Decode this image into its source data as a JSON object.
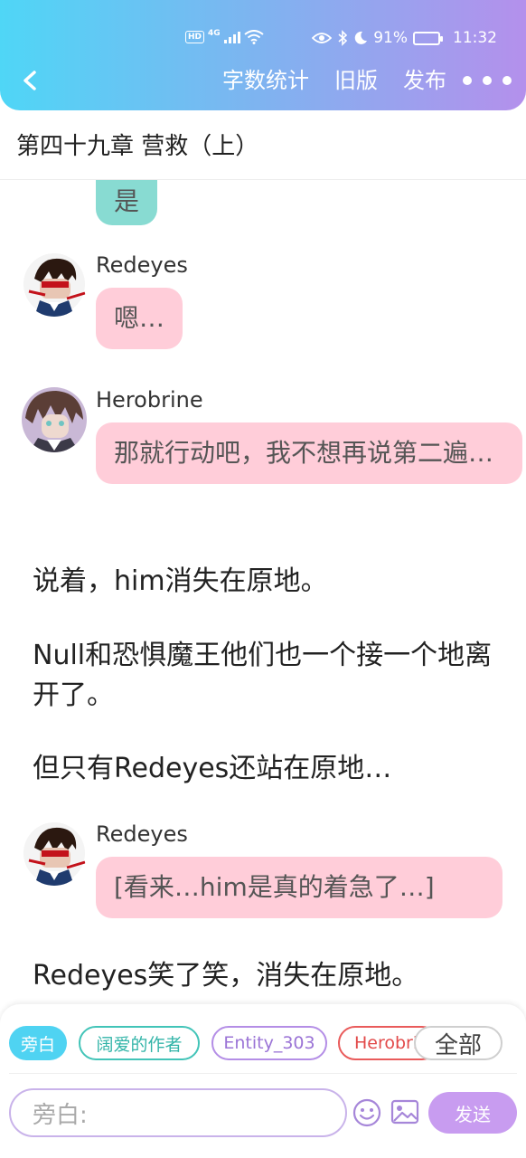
{
  "status_bar": {
    "hd": "HD",
    "network": "4G",
    "battery_percent": "91%",
    "battery_level": 0.91,
    "time": "11:32"
  },
  "nav": {
    "word_count": "字数统计",
    "old_version": "旧版",
    "publish": "发布"
  },
  "chapter": {
    "title": "第四十九章 营救（上）"
  },
  "messages": [
    {
      "type": "bubble",
      "color": "teal",
      "text": "是"
    },
    {
      "type": "bubble",
      "color": "pink",
      "sender": "Redeyes",
      "text": "嗯…"
    },
    {
      "type": "bubble",
      "color": "pink",
      "sender": "Herobrine",
      "text": "那就行动吧，我不想再说第二遍…"
    },
    {
      "type": "narration",
      "text": "说着，him消失在原地。"
    },
    {
      "type": "narration",
      "text": "Null和恐惧魔王他们也一个接一个地离开了。"
    },
    {
      "type": "narration",
      "text": "但只有Redeyes还站在原地…"
    },
    {
      "type": "bubble",
      "color": "pink",
      "sender": "Redeyes",
      "text": "[看来…him是真的着急了…]"
    },
    {
      "type": "narration",
      "text": "Redeyes笑了笑，消失在原地。"
    }
  ],
  "roles": {
    "active": "旁白",
    "items": [
      "阔爱的作者",
      "Entity_303",
      "Herobri"
    ],
    "all": "全部"
  },
  "composer": {
    "placeholder": "旁白:",
    "send": "发送"
  },
  "colors": {
    "header_gradient_start": "#4fd6f6",
    "header_gradient_end": "#b490ec",
    "pink_bubble": "#ffcdd9",
    "teal_bubble": "#88dbd2",
    "send_button": "#c89cf0"
  }
}
